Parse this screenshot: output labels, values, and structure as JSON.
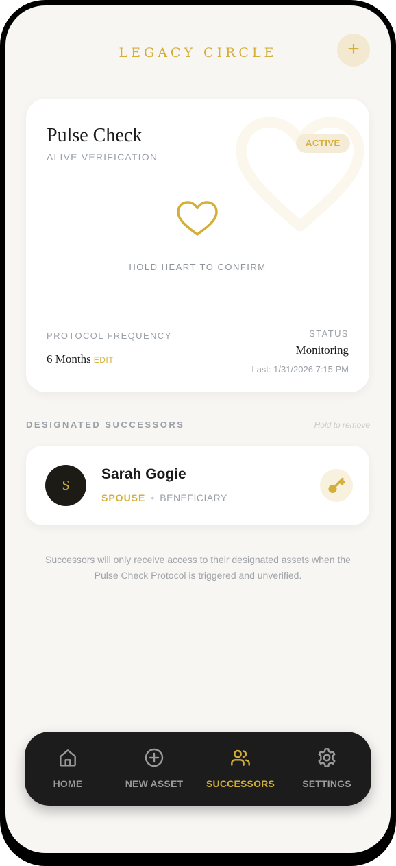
{
  "header": {
    "title": "LEGACY CIRCLE",
    "add_icon": "plus-icon",
    "add_label": "+"
  },
  "pulse_card": {
    "title": "Pulse Check",
    "subtitle": "ALIVE VERIFICATION",
    "badge": "ACTIVE",
    "heart_icon": "heart-icon",
    "hold_label": "HOLD HEART TO CONFIRM",
    "frequency_label": "PROTOCOL FREQUENCY",
    "frequency_value": "6 Months",
    "edit_label": "EDIT",
    "status_label": "STATUS",
    "status_value": "Monitoring",
    "last_check": "Last: 1/31/2026 7:15 PM"
  },
  "successors": {
    "section_title": "DESIGNATED SUCCESSORS",
    "hint": "Hold to remove",
    "items": [
      {
        "initial": "S",
        "name": "Sarah Gogie",
        "relation": "SPOUSE",
        "separator": "•",
        "role": "BENEFICIARY",
        "icon": "key-icon"
      }
    ]
  },
  "note": "Successors will only receive access to their designated assets when the Pulse Check Protocol is triggered and unverified.",
  "nav": {
    "items": [
      {
        "label": "HOME",
        "icon": "home-icon",
        "active": false
      },
      {
        "label": "NEW ASSET",
        "icon": "plus-circle-icon",
        "active": false
      },
      {
        "label": "SUCCESSORS",
        "icon": "users-icon",
        "active": true
      },
      {
        "label": "SETTINGS",
        "icon": "gear-icon",
        "active": false
      }
    ]
  },
  "colors": {
    "accent": "#d4af37",
    "background": "#f8f6f3",
    "nav_bg": "#1c1c1c",
    "text": "#1a1a1a",
    "muted": "#9aa0a8"
  }
}
